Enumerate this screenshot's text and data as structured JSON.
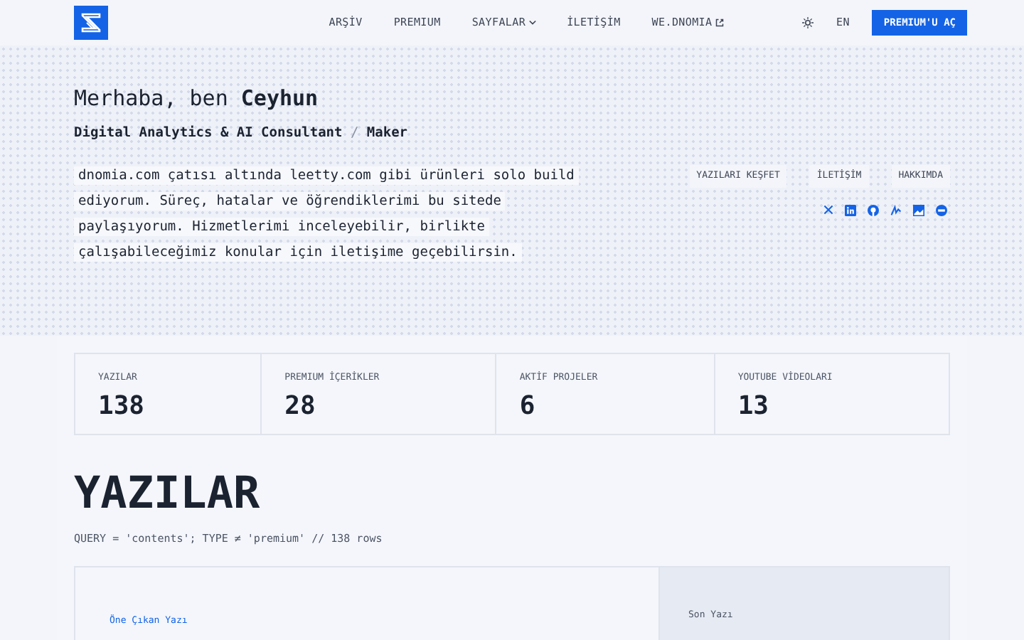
{
  "nav": {
    "links": [
      {
        "label": "ARŞİV",
        "kind": "plain"
      },
      {
        "label": "PREMIUM",
        "kind": "plain"
      },
      {
        "label": "SAYFALAR",
        "kind": "dropdown"
      },
      {
        "label": "İLETİŞİM",
        "kind": "plain"
      },
      {
        "label": "WE.DNOMIA",
        "kind": "external"
      }
    ],
    "language": "EN",
    "cta": "PREMIUM'U AÇ"
  },
  "hero": {
    "greeting": "Merhaba, ben **Ceyhun**",
    "role": "Digital Analytics & AI Consultant",
    "separator": "/",
    "role_extra": "Maker",
    "intro_lines": [
      "dnomia.com çatısı altında leetty.com gibi ürünleri solo build",
      "ediyorum. Süreç, hatalar ve öğrendiklerimi bu sitede",
      "paylaşıyorum. Hizmetlerimi inceleyebilir, birlikte",
      "çalışabileceğimiz konular için iletişime geçebilirsin."
    ],
    "buttons": [
      "YAZILARI KEŞFET",
      "İLETİŞİM",
      "HAKKIMDA"
    ]
  },
  "stats": [
    {
      "label": "YAZILAR",
      "value": "138"
    },
    {
      "label": "PREMIUM İÇERİKLER",
      "value": "28"
    },
    {
      "label": "AKTİF PROJELER",
      "value": "6"
    },
    {
      "label": "YOUTUBE VİDEOLARI",
      "value": "13"
    }
  ],
  "section": {
    "title": "YAZILAR",
    "query": "QUERY = 'contents'; TYPE ≠ 'premium' // 138 rows"
  },
  "featured": {
    "label": "Öne Çıkan Yazı",
    "side_label": "Son Yazı"
  }
}
